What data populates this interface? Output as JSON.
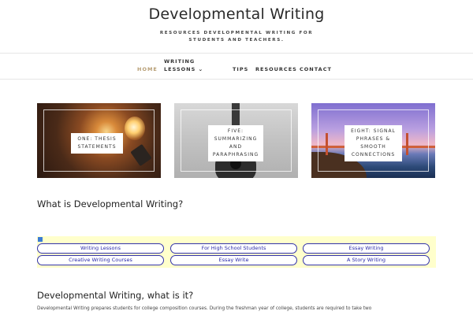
{
  "header": {
    "title": "Developmental Writing",
    "description": "Resources developmental writing for students and teachers."
  },
  "nav": {
    "items": [
      {
        "label": "Home",
        "active": true
      },
      {
        "label": "Writing Lessons",
        "has_dropdown": true
      },
      {
        "label": "Tips"
      },
      {
        "label": "Resources"
      },
      {
        "label": "Contact"
      }
    ]
  },
  "cards": [
    {
      "label": "One: Thesis Statements",
      "image": "light-bulb-photo"
    },
    {
      "label": "Five: Summarizing and Paraphrasing",
      "image": "guitar-photo"
    },
    {
      "label": "Eight: Signal Phrases & Smooth Connections",
      "image": "bridge-sunset-photo"
    }
  ],
  "section1": {
    "title": "What is Developmental Writing?"
  },
  "ads": {
    "links": [
      "Writing Lessons",
      "For High School Students",
      "Essay Writing",
      "Creative Writing Courses",
      "Essay Write",
      "A Story Writing"
    ],
    "background": "#ffffcc",
    "link_color": "#2a2aaa"
  },
  "section2": {
    "title": "Developmental Writing, what is it?",
    "body": "Developmental Writing prepares students for college composition courses. During the freshman year of college, students are required to take two"
  },
  "colors": {
    "accent": "#b79e74"
  }
}
